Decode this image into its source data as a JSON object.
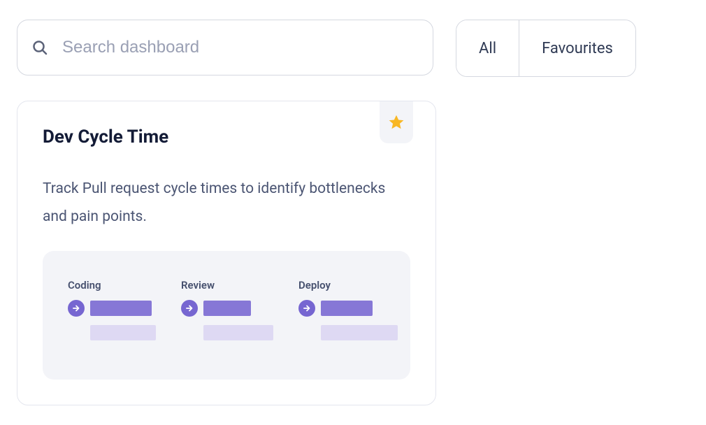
{
  "search": {
    "placeholder": "Search dashboard"
  },
  "filters": {
    "all": "All",
    "favourites": "Favourites"
  },
  "card": {
    "title": "Dev Cycle Time",
    "description": "Track Pull request cycle times to identify bottlenecks and pain points.",
    "favourite": true,
    "stages": {
      "0": {
        "label": "Coding"
      },
      "1": {
        "label": "Review"
      },
      "2": {
        "label": "Deploy"
      }
    }
  },
  "colors": {
    "accent": "#7666d1",
    "star": "#f8b725"
  }
}
